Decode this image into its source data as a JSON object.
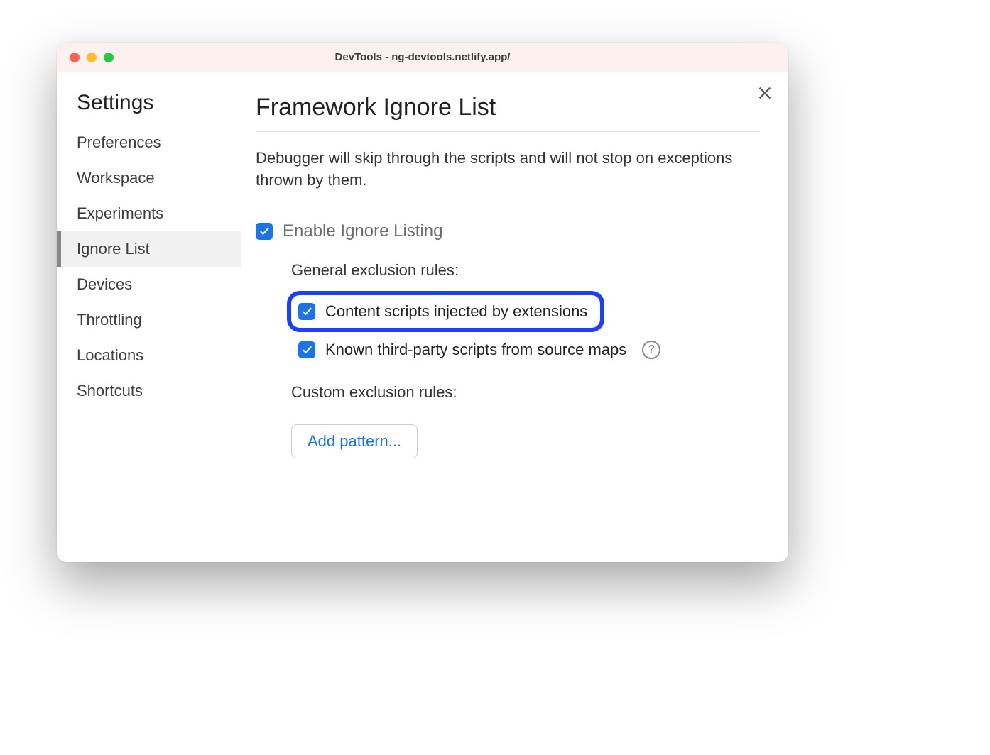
{
  "window": {
    "title": "DevTools - ng-devtools.netlify.app/"
  },
  "sidebar": {
    "title": "Settings",
    "items": [
      {
        "label": "Preferences",
        "active": false
      },
      {
        "label": "Workspace",
        "active": false
      },
      {
        "label": "Experiments",
        "active": false
      },
      {
        "label": "Ignore List",
        "active": true
      },
      {
        "label": "Devices",
        "active": false
      },
      {
        "label": "Throttling",
        "active": false
      },
      {
        "label": "Locations",
        "active": false
      },
      {
        "label": "Shortcuts",
        "active": false
      }
    ]
  },
  "main": {
    "title": "Framework Ignore List",
    "description": "Debugger will skip through the scripts and will not stop on exceptions thrown by them.",
    "enable_label": "Enable Ignore Listing",
    "enable_checked": true,
    "general_section_label": "General exclusion rules:",
    "rule_content_scripts": {
      "label": "Content scripts injected by extensions",
      "checked": true,
      "highlighted": true
    },
    "rule_third_party": {
      "label": "Known third-party scripts from source maps",
      "checked": true,
      "has_help": true
    },
    "custom_section_label": "Custom exclusion rules:",
    "add_pattern_label": "Add pattern..."
  },
  "colors": {
    "accent_checkbox": "#1a73e8",
    "highlight_border": "#1a3fff"
  }
}
